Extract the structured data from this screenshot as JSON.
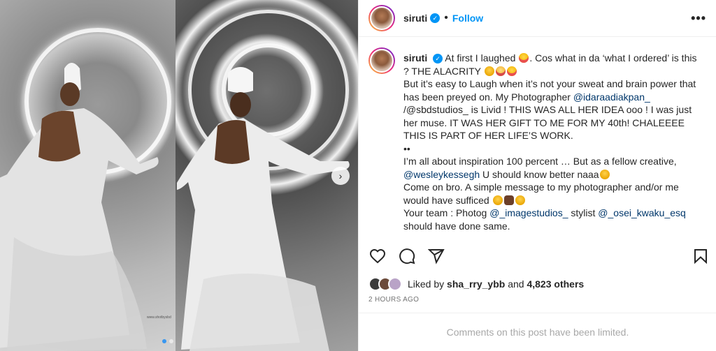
{
  "post": {
    "username": "siruti",
    "verified_mark": "✓",
    "separator": "•",
    "follow_label": "Follow",
    "more_label": "•••"
  },
  "caption": {
    "username": "siruti",
    "line1": "At first I laughed",
    "line1b": ". Cos what in da ‘what I ordered’ is this ? THE ALACRITY",
    "para2": "But it’s easy to Laugh when it’s not your sweat and brain power that has been preyed on. My Photographer",
    "mention1": "@idaraadiakpan_",
    "para2b": "/@sbdstudios_ is Livid ! THIS WAS ALL HER IDEA ooo ! I was just her muse. IT WAS HER GIFT TO ME FOR MY 40th! CHALEEEE THIS IS PART OF HER LIFE’S WORK.",
    "bullets": "••",
    "para3": "I’m all about inspiration 100 percent … But as a fellow creative,",
    "mention2": "@wesleykessegh",
    "para3b": "U should know better naaa",
    "para4": "Come on bro. A simple message to my photographer and/or me would have sufficed",
    "para5a": "Your team : Photog",
    "mention3": "@_imagestudios_",
    "para5b": "stylist",
    "mention4": "@_osei_kwaku_esq",
    "para5c": "should have done same."
  },
  "icons": {
    "like": "heart-icon",
    "comment": "comment-icon",
    "share": "share-icon",
    "save": "bookmark-icon"
  },
  "likes": {
    "prefix": "Liked by",
    "user": "sha_rry_ybb",
    "and": "and",
    "count": "4,823 others"
  },
  "timestamp": "2 HOURS AGO",
  "comments_notice": "Comments on this post have been limited.",
  "media": {
    "watermark": "www.shotbysbd",
    "next_arrow": "›"
  },
  "colors": {
    "accent": "#0095f6",
    "text": "#262626",
    "muted": "#737373"
  }
}
